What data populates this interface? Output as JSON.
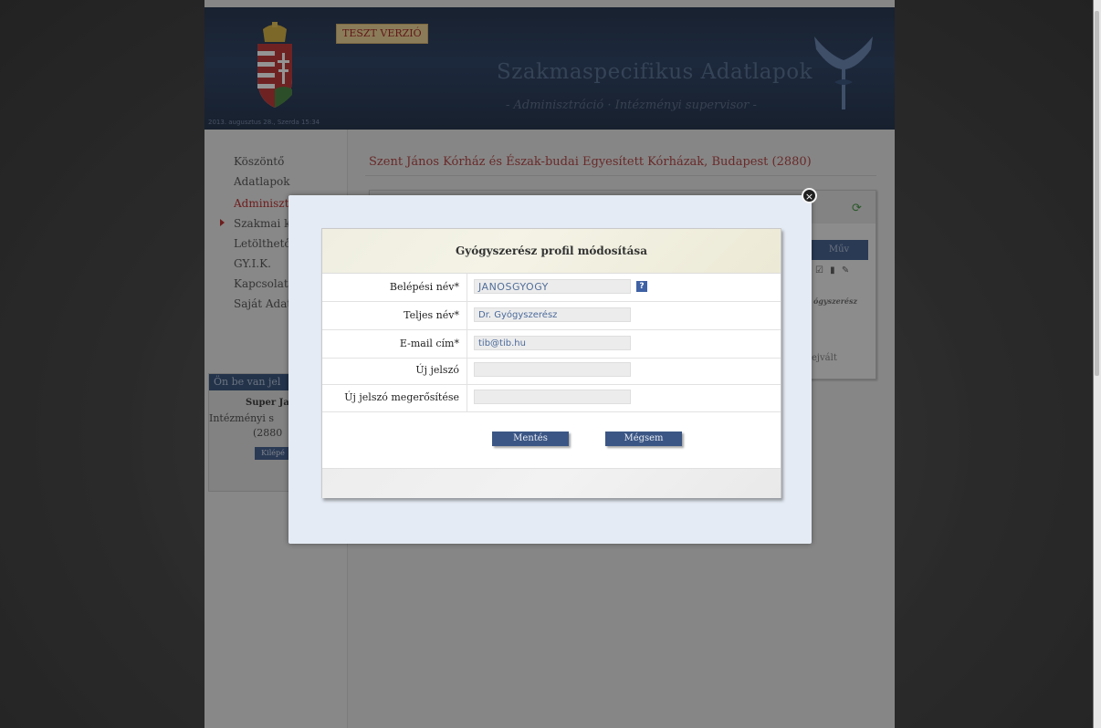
{
  "header": {
    "test_badge": "TESZT VERZIÓ",
    "title": "Szakmaspecifikus Adatlapok",
    "subtitle": "- Adminisztráció · Intézményi supervisor -",
    "date_text": "2013. augusztus 28., Szerda 15:34"
  },
  "sidebar": {
    "items": [
      {
        "label": "Köszöntő"
      },
      {
        "label": "Adatlapok"
      },
      {
        "label": "Adminisztráció"
      },
      {
        "label": "Szakmai k"
      },
      {
        "label": "Letölthető"
      },
      {
        "label": "GY.I.K."
      },
      {
        "label": "Kapcsolat"
      },
      {
        "label": "Saját Adat"
      }
    ],
    "login_box": {
      "heading": "Ön be van jel",
      "user": "Super Ja",
      "role": "Intézményi s",
      "code": "(2880",
      "logout_label": "Kilépé"
    }
  },
  "main": {
    "institution": "Szent János Kórház és Észak-budai Egyesített Kórházak, Budapest (2880)",
    "table_header_action": "Műv",
    "row_label": "ógyszerész",
    "extra_text": "ejvált"
  },
  "dialog": {
    "title": "Gyógyszerész profil módosítása",
    "fields": [
      {
        "label": "Belépési név*",
        "value": "JANOSGYOGY"
      },
      {
        "label": "Teljes név*",
        "value": "Dr. Gyógyszerész"
      },
      {
        "label": "E-mail cím*",
        "value": "tib@tib.hu"
      },
      {
        "label": "Új jelszó",
        "value": ""
      },
      {
        "label": "Új jelszó megerősítése",
        "value": ""
      }
    ],
    "help_label": "?",
    "save_label": "Mentés",
    "cancel_label": "Mégsem",
    "close_label": "×"
  },
  "icons": {
    "close": "close-icon",
    "help": "help-icon",
    "refresh": "refresh-icon",
    "coat_of_arms": "coat-of-arms-icon",
    "logo": "snake-cup-logo-icon"
  },
  "colors": {
    "header_bg": "#24385a",
    "accent_red": "#b02525",
    "button_blue": "#3b5685",
    "badge_bg": "#e2c98c"
  }
}
